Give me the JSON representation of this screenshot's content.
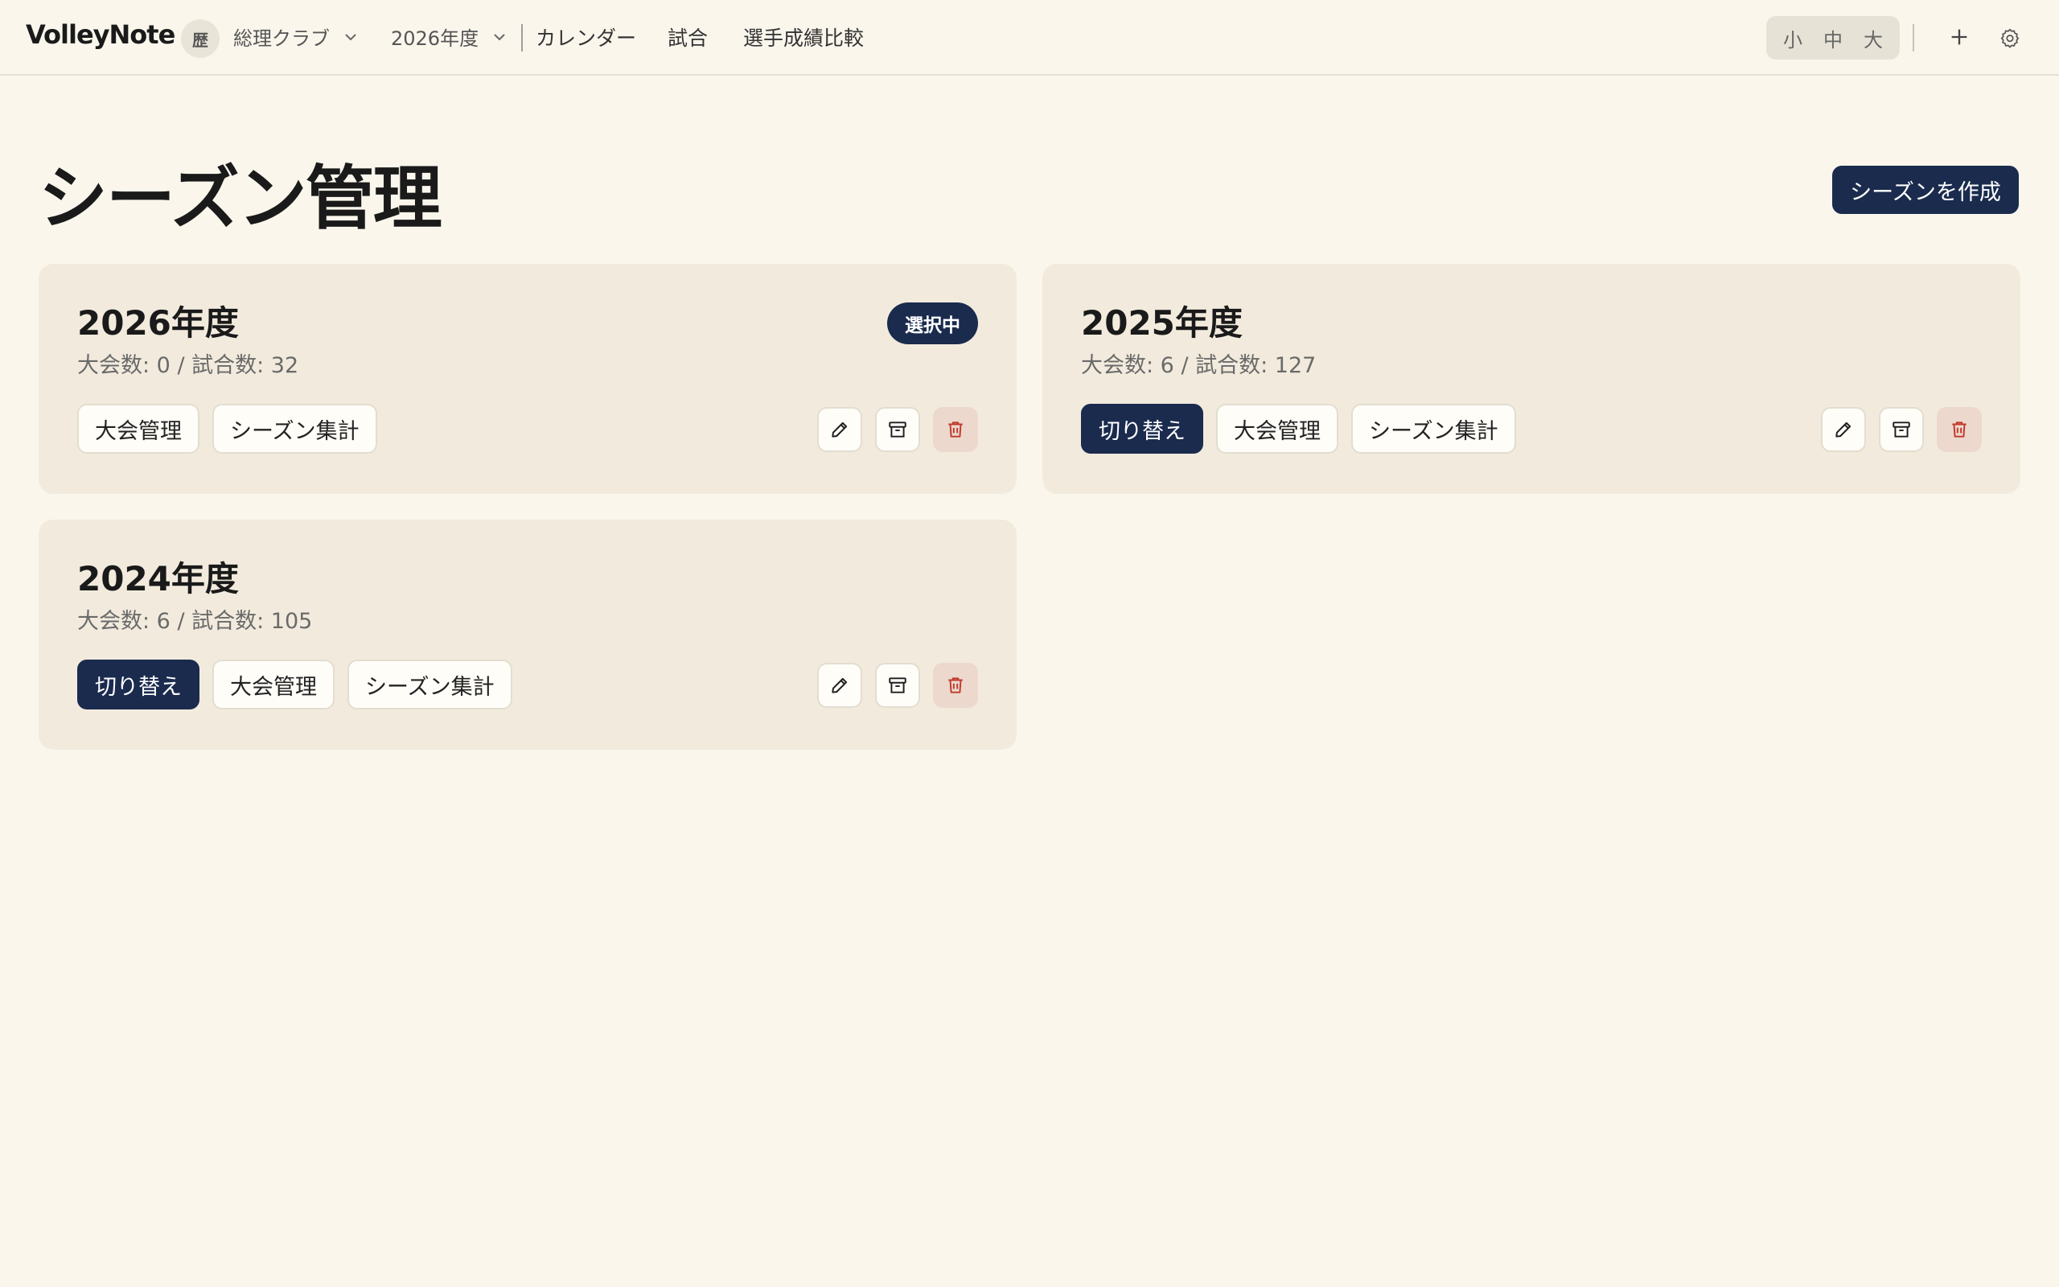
{
  "header": {
    "brand": "VolleyNote",
    "club_avatar": "歴",
    "club_name": "総理クラブ",
    "season": "2026年度",
    "nav": {
      "calendar": "カレンダー",
      "match": "試合",
      "compare": "選手成績比較"
    },
    "size_toggle": {
      "small": "小",
      "medium": "中",
      "large": "大"
    }
  },
  "page": {
    "title": "シーズン管理",
    "create_button": "シーズンを作成"
  },
  "seasons": [
    {
      "title": "2026年度",
      "meta": "大会数: 0 / 試合数: 32",
      "badge": "選択中",
      "tournament_button": "大会管理",
      "summary_button": "シーズン集計"
    },
    {
      "title": "2025年度",
      "meta": "大会数: 6 / 試合数: 127",
      "switch_button": "切り替え",
      "tournament_button": "大会管理",
      "summary_button": "シーズン集計"
    },
    {
      "title": "2024年度",
      "meta": "大会数: 6 / 試合数: 105",
      "switch_button": "切り替え",
      "tournament_button": "大会管理",
      "summary_button": "シーズン集計"
    }
  ],
  "colors": {
    "background": "#faf6ec",
    "card": "#f2ebdd",
    "primary": "#1a2b4e",
    "danger": "#c0392b"
  },
  "icons": [
    "chevron-down-icon",
    "plus-icon",
    "gear-icon",
    "pencil-icon",
    "archive-icon",
    "trash-icon"
  ]
}
